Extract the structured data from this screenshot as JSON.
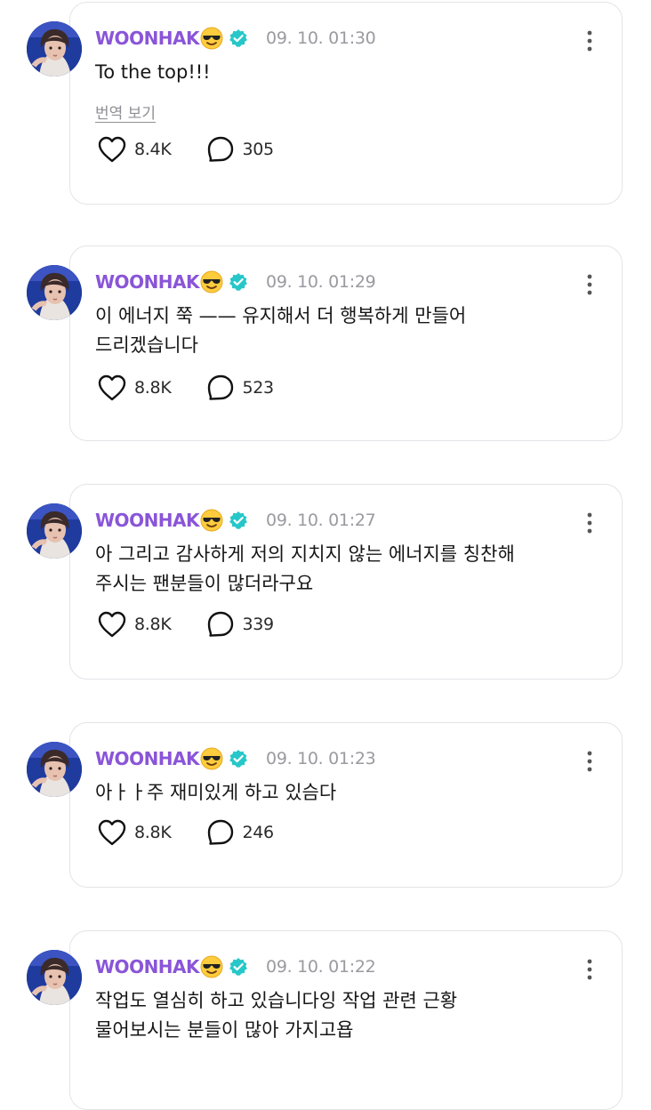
{
  "colors": {
    "author": "#8a55d8",
    "verified": "#27c7c9",
    "timestamp": "#9a9aa0",
    "card_border": "#e4e4e8"
  },
  "icons": {
    "emoji": "smiling-face-with-sunglasses-icon",
    "verified": "verified-badge-icon",
    "more": "more-vertical-icon",
    "like": "heart-outline-icon",
    "comment": "comment-bubble-icon"
  },
  "posts": [
    {
      "author": "WOONHAK",
      "timestamp": "09. 10. 01:30",
      "text": "To the top!!!",
      "translate_label": "번역 보기",
      "likes": "8.4K",
      "comments": "305"
    },
    {
      "author": "WOONHAK",
      "timestamp": "09. 10. 01:29",
      "text": "이 에너지 쭉 —— 유지해서 더 행복하게 만들어\n드리겠습니다",
      "likes": "8.8K",
      "comments": "523"
    },
    {
      "author": "WOONHAK",
      "timestamp": "09. 10. 01:27",
      "text": "아 그리고 감사하게 저의 지치지 않는 에너지를 칭찬해\n주시는 팬분들이 많더라구요",
      "likes": "8.8K",
      "comments": "339"
    },
    {
      "author": "WOONHAK",
      "timestamp": "09. 10. 01:23",
      "text": "아ㅏㅏ주 재미있게 하고 있슴다",
      "likes": "8.8K",
      "comments": "246"
    },
    {
      "author": "WOONHAK",
      "timestamp": "09. 10. 01:22",
      "text": "작업도 열심히 하고 있습니다잉 작업 관련 근황\n물어보시는 분들이 많아 가지고욥"
    }
  ]
}
